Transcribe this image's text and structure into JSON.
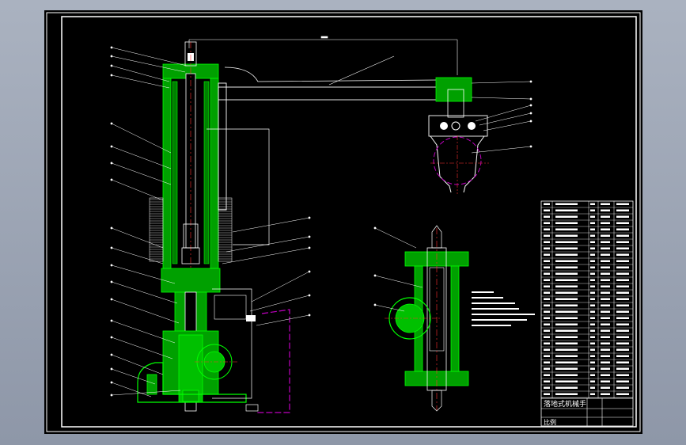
{
  "colors": {
    "background": "#000000",
    "frame": "#ffffff",
    "part_fill": "#00a000",
    "part_edge": "#00ff00",
    "centerline": "#ff3030",
    "phantom": "#c000c0",
    "title_text": "#ffffff"
  },
  "title_block": {
    "name_label": "落地式机械手",
    "scale_label": "比例"
  }
}
